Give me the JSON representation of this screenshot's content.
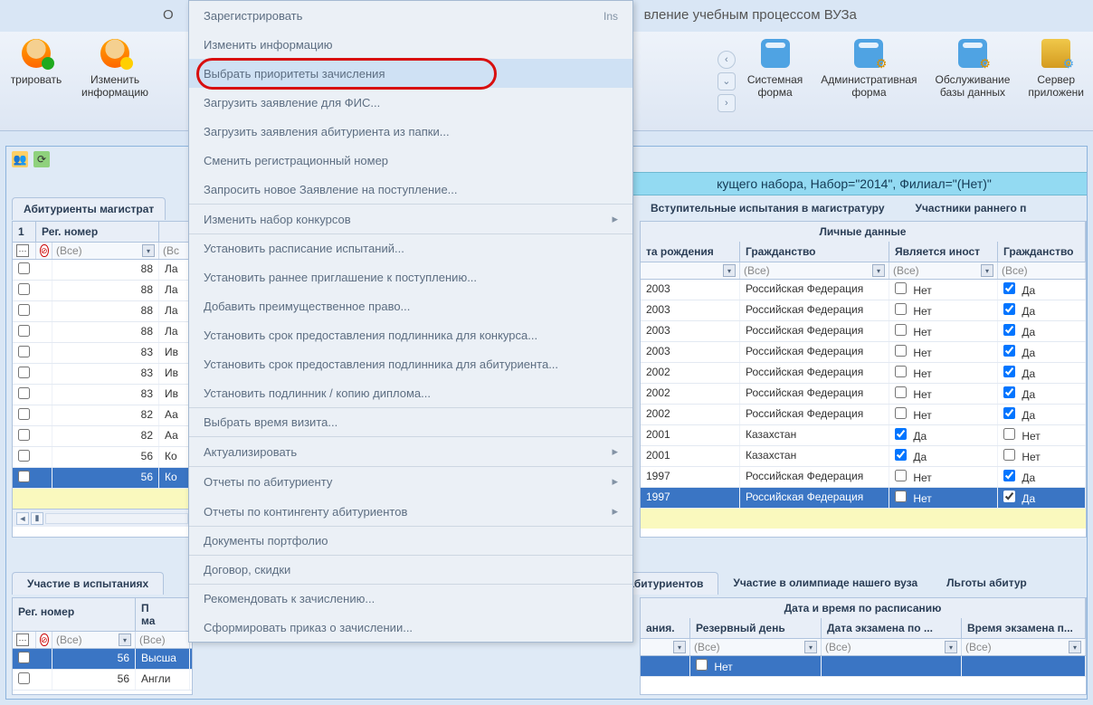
{
  "app_title_prefix": "О",
  "app_title_suffix": "вление учебным процессом ВУЗа",
  "toolbar": {
    "register": "трировать",
    "edit_info_l1": "Изменить",
    "edit_info_l2": "информацию",
    "sys_form_l1": "Системная",
    "sys_form_l2": "форма",
    "adm_form_l1": "Административная",
    "adm_form_l2": "форма",
    "maint_l1": "Обслуживание",
    "maint_l2": "базы данных",
    "server_l1": "Сервер",
    "server_l2": "приложени"
  },
  "menu": [
    {
      "label": "Зарегистрировать",
      "shortcut": "Ins"
    },
    {
      "label": "Изменить информацию"
    },
    {
      "label": "Выбрать приоритеты зачисления",
      "highlight": true
    },
    {
      "label": "Загрузить заявление для ФИС..."
    },
    {
      "label": "Загрузить заявления абитуриента из папки..."
    },
    {
      "label": "Сменить регистрационный номер"
    },
    {
      "label": "Запросить новое Заявление на поступление..."
    },
    {
      "label": "Изменить набор конкурсов",
      "sub": true,
      "sep": true
    },
    {
      "label": "Установить расписание испытаний...",
      "sep": true
    },
    {
      "label": "Установить раннее приглашение к поступлению..."
    },
    {
      "label": "Добавить преимущественное право..."
    },
    {
      "label": "Установить срок предоставления подлинника для конкурса..."
    },
    {
      "label": "Установить срок предоставления подлинника для абитуриента..."
    },
    {
      "label": "Установить подлинник / копию диплома..."
    },
    {
      "label": "Выбрать время визита...",
      "sep": true
    },
    {
      "label": "Актуализировать",
      "sub": true,
      "sep": true
    },
    {
      "label": "Отчеты по абитуриенту",
      "sub": true,
      "sep": true
    },
    {
      "label": "Отчеты по контингенту абитуриентов",
      "sub": true
    },
    {
      "label": "Документы портфолио",
      "sep": true
    },
    {
      "label": "Договор, скидки",
      "sep": true
    },
    {
      "label": "Рекомендовать к зачислению...",
      "sep": true
    },
    {
      "label": "Сформировать приказ о зачислении..."
    }
  ],
  "title_bar": "кущего набора, Набор=\"2014\", Филиал=\"(Нет)\"",
  "left_tab": "Абитуриенты магистрат",
  "right_tabs": [
    "Вступительные испытания в магистратуру",
    "Участники раннего п"
  ],
  "personal_header": "Личные данные",
  "columns": {
    "idx": "1",
    "reg_no": "Рег. номер",
    "birth": "та рождения",
    "citizenship": "Гражданство",
    "is_foreign": "Является иност",
    "citizen2": "Гражданство"
  },
  "filter_all": "(Все)",
  "filter_all_short": "(Вс",
  "rows": [
    {
      "reg": "88",
      "name": "Ла",
      "year": "2003",
      "cit": "Российская Федерация",
      "foreign": "Нет",
      "foreign_chk": false,
      "c2": "Да",
      "c2_chk": true
    },
    {
      "reg": "88",
      "name": "Ла",
      "year": "2003",
      "cit": "Российская Федерация",
      "foreign": "Нет",
      "foreign_chk": false,
      "c2": "Да",
      "c2_chk": true
    },
    {
      "reg": "88",
      "name": "Ла",
      "year": "2003",
      "cit": "Российская Федерация",
      "foreign": "Нет",
      "foreign_chk": false,
      "c2": "Да",
      "c2_chk": true
    },
    {
      "reg": "88",
      "name": "Ла",
      "year": "2003",
      "cit": "Российская Федерация",
      "foreign": "Нет",
      "foreign_chk": false,
      "c2": "Да",
      "c2_chk": true
    },
    {
      "reg": "83",
      "name": "Ив",
      "year": "2002",
      "cit": "Российская Федерация",
      "foreign": "Нет",
      "foreign_chk": false,
      "c2": "Да",
      "c2_chk": true
    },
    {
      "reg": "83",
      "name": "Ив",
      "year": "2002",
      "cit": "Российская Федерация",
      "foreign": "Нет",
      "foreign_chk": false,
      "c2": "Да",
      "c2_chk": true
    },
    {
      "reg": "83",
      "name": "Ив",
      "year": "2002",
      "cit": "Российская Федерация",
      "foreign": "Нет",
      "foreign_chk": false,
      "c2": "Да",
      "c2_chk": true
    },
    {
      "reg": "82",
      "name": "Аа",
      "year": "2001",
      "cit": "Казахстан",
      "foreign": "Да",
      "foreign_chk": true,
      "c2": "Нет",
      "c2_chk": false
    },
    {
      "reg": "82",
      "name": "Аа",
      "year": "2001",
      "cit": "Казахстан",
      "foreign": "Да",
      "foreign_chk": true,
      "c2": "Нет",
      "c2_chk": false
    },
    {
      "reg": "56",
      "name": "Ко",
      "year": "1997",
      "cit": "Российская Федерация",
      "foreign": "Нет",
      "foreign_chk": false,
      "c2": "Да",
      "c2_chk": true
    },
    {
      "reg": "56",
      "name": "Ко",
      "year": "1997",
      "cit": "Российская Федерация",
      "foreign": "Нет",
      "foreign_chk": false,
      "c2": "Да",
      "c2_chk": true,
      "selected": true
    }
  ],
  "bottom_left_tab": "Участие в испытаниях",
  "bottom_right_tabs": [
    "абитуриентов",
    "Участие в олимпиаде нашего вуза",
    "Льготы абитур"
  ],
  "bottom_header": "Дата и время по расписанию",
  "bottom_cols": {
    "reg_no": "Рег. номер",
    "p2_l1": "П",
    "p2_l2": "ма",
    "c1": "ания.",
    "c2": "Резервный день",
    "c3": "Дата экзамена по ...",
    "c4": "Время экзамена п..."
  },
  "bottom_rows_left": [
    {
      "reg": "56",
      "name": "Высша",
      "selected": true
    },
    {
      "reg": "56",
      "name": "Англи"
    }
  ],
  "bottom_rows_right": [
    {
      "reserve": "Нет",
      "chk": false,
      "selected": true
    }
  ]
}
